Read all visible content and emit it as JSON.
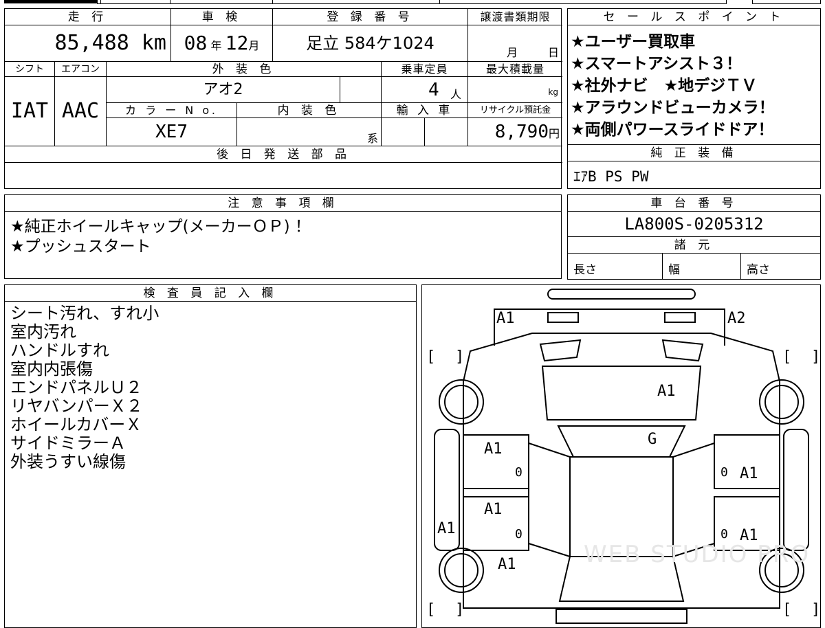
{
  "vehicle_info": {
    "mileage_header": "走 行",
    "inspection_header": "車 検",
    "registration_header": "登 録 番 号",
    "transfer_deadline_header": "譲渡書類期限",
    "mileage": "85,488 km",
    "inspection_year": "08",
    "inspection_year_unit": "年",
    "inspection_month": "12",
    "inspection_month_unit": "月",
    "registration_number": "足立 584ケ1024",
    "transfer_month_unit": "月",
    "transfer_day_unit": "日",
    "shift_header": "シフト",
    "ac_header": "エアコン",
    "exterior_color_header": "外 装 色",
    "capacity_header": "乗車定員",
    "max_load_header": "最大積載量",
    "shift": "IAT",
    "ac": "AAC",
    "exterior_color": "アオ2",
    "capacity": "4",
    "capacity_unit": "人",
    "max_load_unit": "kg",
    "color_no_header": "カ ラ ー N o.",
    "interior_color_header": "内 装 色",
    "import_header": "輸 入 車",
    "recycle_header": "リサイクル預託金",
    "color_no": "XE7",
    "interior_color_suffix": "系",
    "recycle_fee": "8,790",
    "recycle_fee_unit": "円",
    "later_parts_header": "後 日 発 送 部 品"
  },
  "sales_points": {
    "header": "セ ー ル ス ポ イ ン ト",
    "items": [
      "★ユーザー買取車",
      "★スマートアシスト３！",
      "★社外ナビ　★地デジＴＶ",
      "★アラウンドビューカメラ！",
      "★両側パワースライドドア！"
    ]
  },
  "genuine_equipment": {
    "header": "純 正 装 備",
    "value": "ｴｱB PS PW"
  },
  "notes": {
    "header": "注 意 事 項 欄",
    "items": [
      "★純正ホイールキャップ(メーカーＯＰ) ！",
      "★プッシュスタート"
    ]
  },
  "chassis": {
    "header": "車 台 番 号",
    "value": "LA800S-0205312"
  },
  "specs": {
    "header": "諸 元",
    "length_label": "長さ",
    "width_label": "幅",
    "height_label": "高さ"
  },
  "inspector": {
    "header": "検 査 員 記 入 欄",
    "items": [
      "シート汚れ、すれ小",
      "室内汚れ",
      "ハンドルすれ",
      "室内内張傷",
      "エンドパネルＵ２",
      "リヤバンパーＸ２",
      "ホイールカバーＸ",
      "サイドミラーＡ",
      "外装うすい線傷"
    ]
  },
  "diagram": {
    "marks": {
      "front_left": "A1",
      "front_right": "A2",
      "bonnet": "A1",
      "windshield": "G",
      "left_front_door": "A1",
      "left_front_door_count": "0",
      "right_front_door": "A1",
      "right_front_door_count": "0",
      "left_rear_door": "A1",
      "left_rear_door_count": "0",
      "right_rear_door": "A1",
      "right_rear_door_count": "0",
      "left_side": "A1",
      "left_rear_quarter": "A1"
    },
    "bracket_left": "[",
    "bracket_right": "]",
    "watermark": "WEB STUDIO PRO"
  }
}
